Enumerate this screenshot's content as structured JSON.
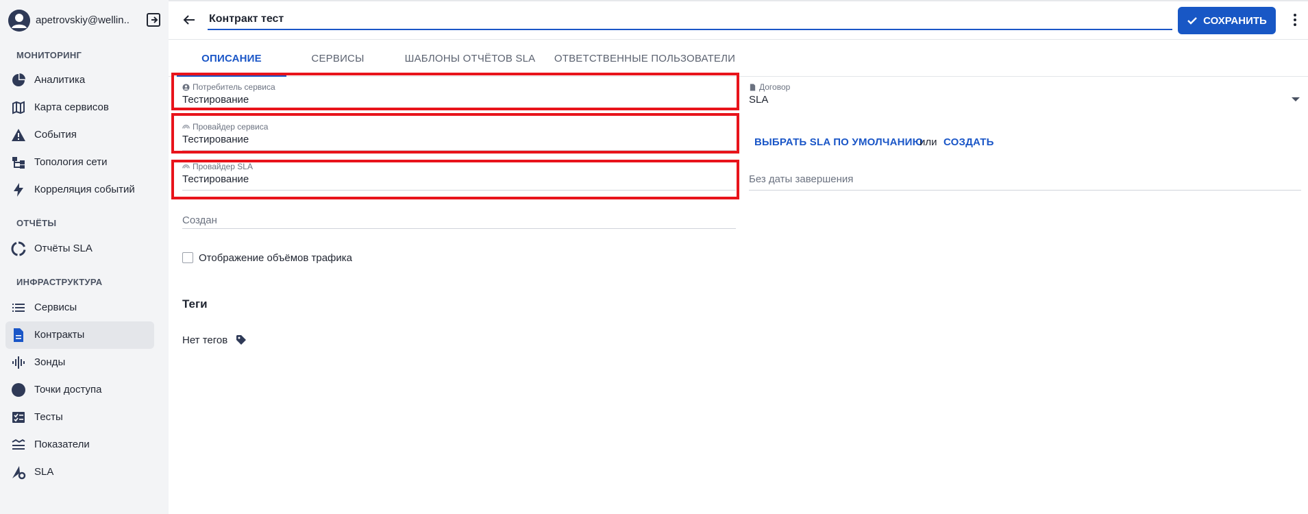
{
  "user": {
    "name": "apetrovskiy@wellin..."
  },
  "sidebar": {
    "sections": [
      {
        "title": "МОНИТОРИНГ"
      },
      {
        "title": "ОТЧЁТЫ"
      },
      {
        "title": "ИНФРАСТРУКТУРА"
      }
    ],
    "items": [
      {
        "label": "Аналитика",
        "icon": "pie-chart-icon"
      },
      {
        "label": "Карта сервисов",
        "icon": "map-icon"
      },
      {
        "label": "События",
        "icon": "warning-icon"
      },
      {
        "label": "Топология сети",
        "icon": "topology-icon"
      },
      {
        "label": "Корреляция событий",
        "icon": "lightning-icon"
      },
      {
        "label": "Отчёты SLA",
        "icon": "circle-progress-icon"
      },
      {
        "label": "Сервисы",
        "icon": "list-icon"
      },
      {
        "label": "Контракты",
        "icon": "document-icon",
        "active": true
      },
      {
        "label": "Зонды",
        "icon": "probe-icon"
      },
      {
        "label": "Точки доступа",
        "icon": "dot-icon"
      },
      {
        "label": "Тесты",
        "icon": "tests-icon"
      },
      {
        "label": "Показатели",
        "icon": "metrics-icon"
      },
      {
        "label": "SLA",
        "icon": "sla-gear-icon"
      }
    ]
  },
  "header": {
    "title_value": "Контракт тест",
    "save_label": "СОХРАНИТЬ"
  },
  "tabs": [
    {
      "label": "ОПИСАНИЕ",
      "active": true
    },
    {
      "label": "СЕРВИСЫ"
    },
    {
      "label": "ШАБЛОНЫ ОТЧЁТОВ SLA"
    },
    {
      "label": "ОТВЕТСТВЕННЫЕ ПОЛЬЗОВАТЕЛИ"
    }
  ],
  "form": {
    "consumer": {
      "label": "Потребитель сервиса",
      "value": "Тестирование"
    },
    "provider": {
      "label": "Провайдер сервиса",
      "value": "Тестирование"
    },
    "sla_provider": {
      "label": "Провайдер SLA",
      "value": "Тестирование"
    },
    "created": {
      "placeholder": "Создан"
    },
    "traffic_checkbox": {
      "label": "Отображение объёмов трафика",
      "checked": false
    },
    "contract": {
      "label": "Договор",
      "value": "SLA"
    },
    "choose_default_sla": "ВЫБРАТЬ SLA ПО УМОЛЧАНИЮ",
    "or_text": "или",
    "create_label": "СОЗДАТЬ",
    "end_date": {
      "placeholder": "Без даты завершения"
    },
    "tags_title": "Теги",
    "no_tags": "Нет тегов"
  },
  "colors": {
    "accent": "#1a56c7",
    "save_button": "#1857c5",
    "highlight": "#e8141b",
    "sidebar_bg": "#f3f4f6",
    "active_item_bg": "#e4e6ea"
  }
}
